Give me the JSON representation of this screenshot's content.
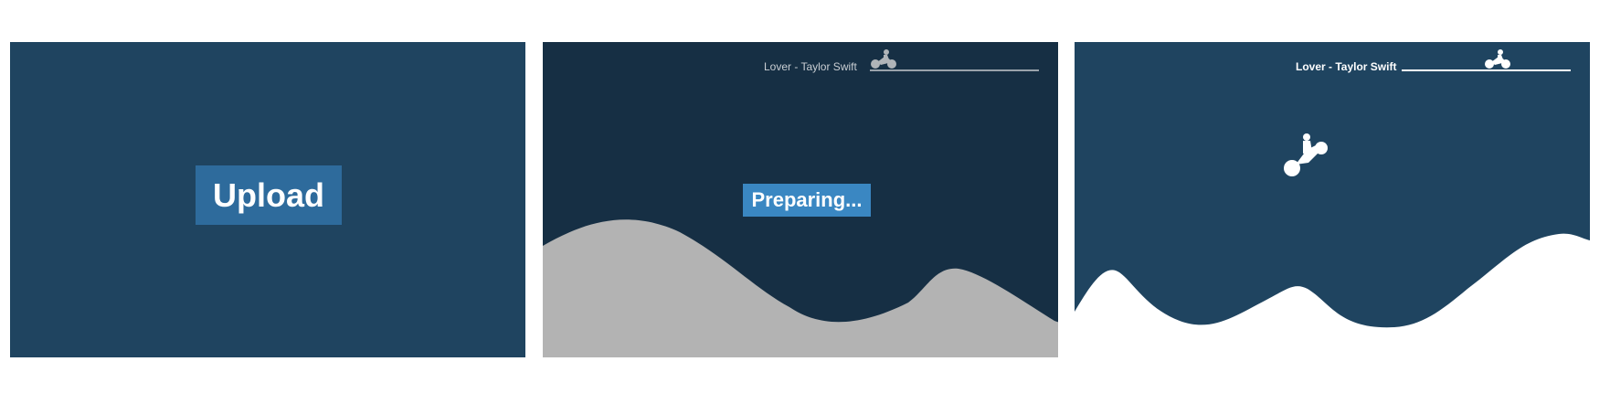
{
  "panels": [
    {
      "id": "upload-screen",
      "button_label": "Upload"
    },
    {
      "id": "preparing-screen",
      "song_title": "Lover - Taylor Swift",
      "button_label": "Preparing...",
      "terrain_color": "#b3b3b3",
      "icon": "bike-rider-icon"
    },
    {
      "id": "playing-screen",
      "song_title": "Lover - Taylor Swift",
      "terrain_color": "#ffffff",
      "icon": "bike-rider-icon"
    }
  ],
  "colors": {
    "panel_dark": "#162f44",
    "panel_blue": "#1f4460",
    "upload_button": "#2e6b9c",
    "preparing_button": "#3a87c2"
  }
}
